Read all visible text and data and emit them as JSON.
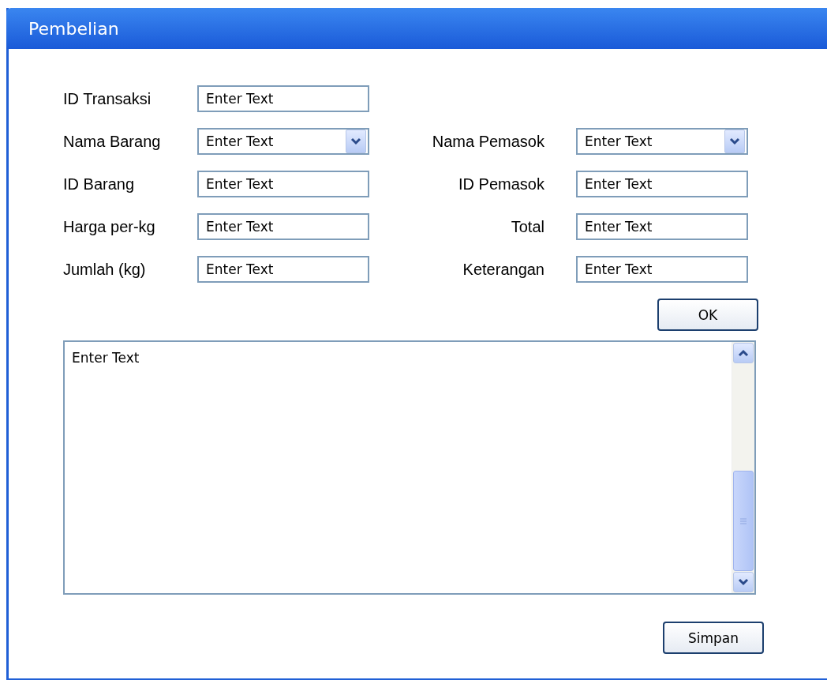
{
  "window": {
    "title": "Pembelian"
  },
  "rows": [
    {
      "left": {
        "label": "ID Transaksi",
        "kind": "text",
        "value": "Enter Text"
      }
    },
    {
      "left": {
        "label": "Nama Barang",
        "kind": "dropdown",
        "value": "Enter Text"
      },
      "right": {
        "label": "Nama Pemasok",
        "kind": "dropdown",
        "value": "Enter Text"
      }
    },
    {
      "left": {
        "label": "ID Barang",
        "kind": "text",
        "value": "Enter Text"
      },
      "right": {
        "label": "ID Pemasok",
        "kind": "text",
        "value": "Enter Text"
      }
    },
    {
      "left": {
        "label": "Harga per-kg",
        "kind": "text",
        "value": "Enter Text"
      },
      "right": {
        "label": "Total",
        "kind": "text",
        "value": "Enter Text"
      }
    },
    {
      "left": {
        "label": "Jumlah (kg)",
        "kind": "text",
        "value": "Enter Text"
      },
      "right": {
        "label": "Keterangan",
        "kind": "text",
        "value": "Enter Text"
      }
    }
  ],
  "ok_button": "OK",
  "text_area": {
    "value": "Enter Text"
  },
  "save_button": "Simpan"
}
